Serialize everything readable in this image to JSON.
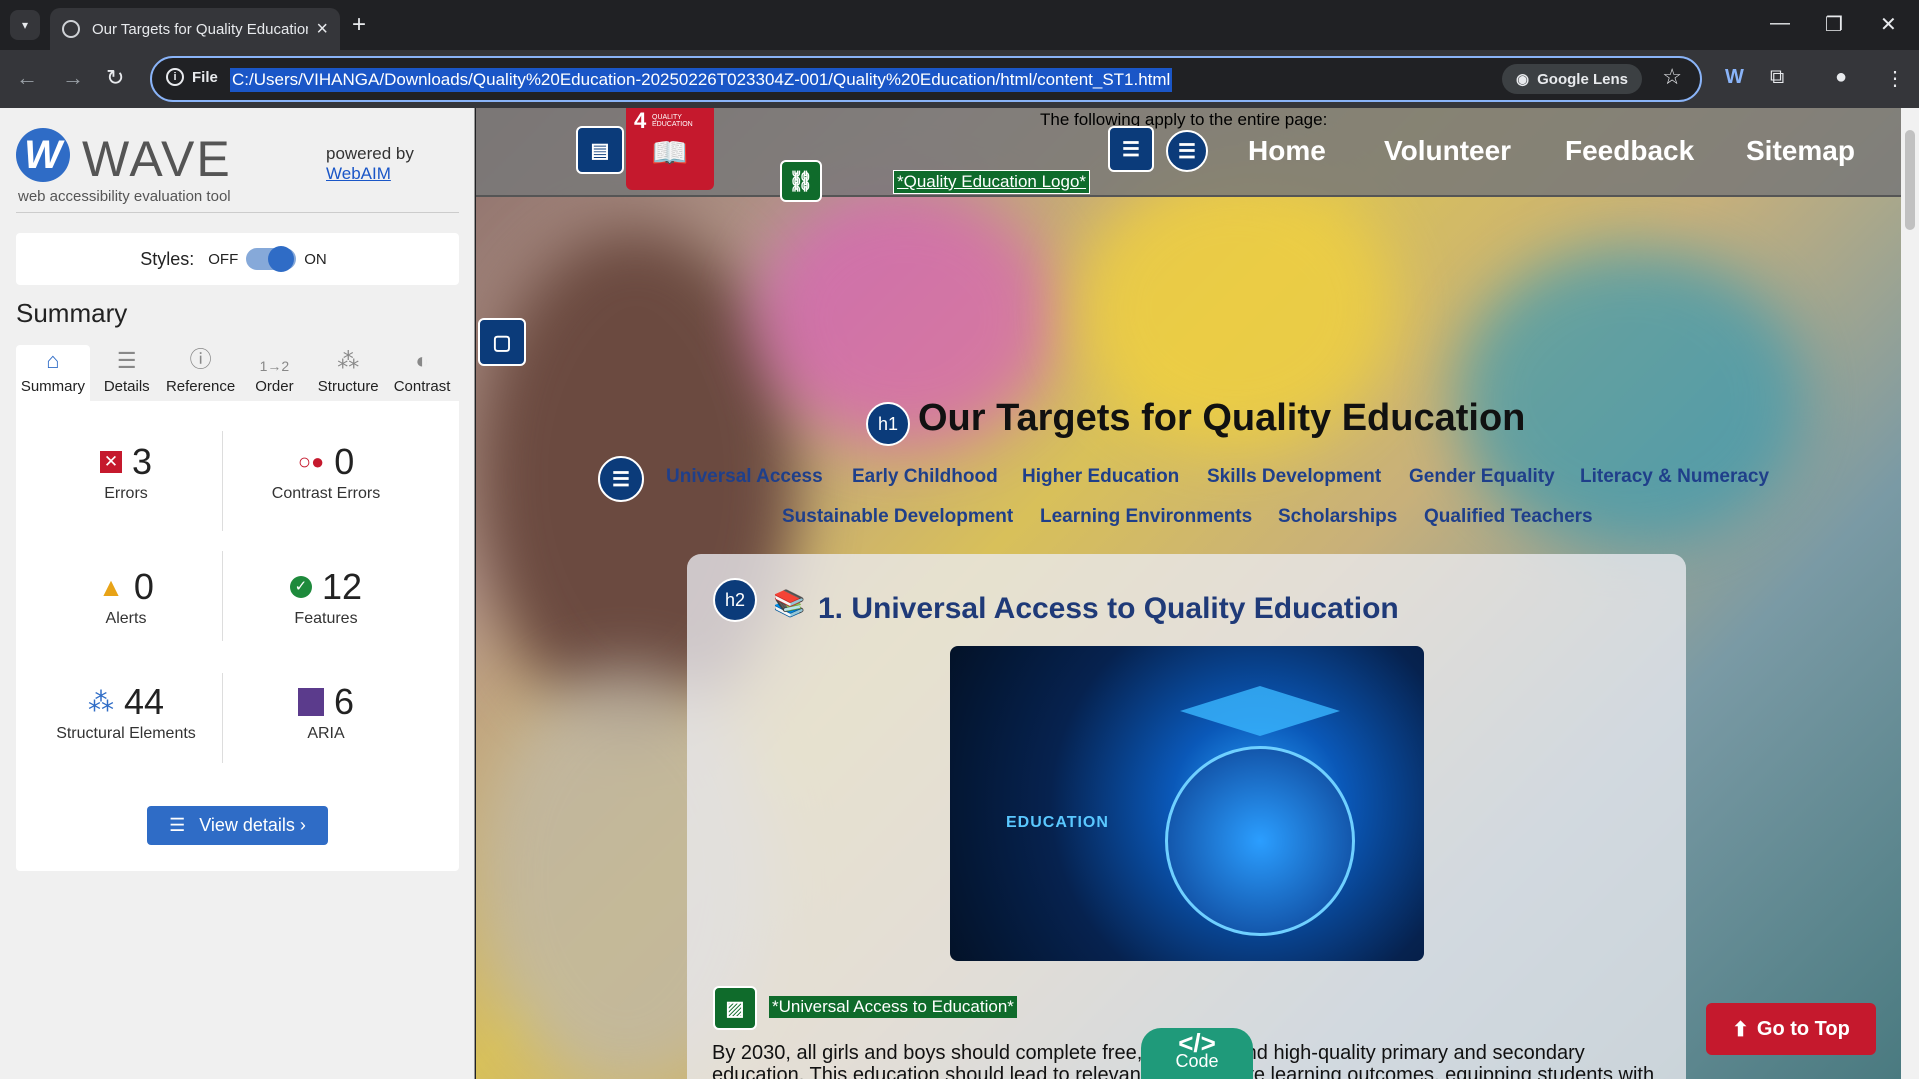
{
  "browser": {
    "tab_title": "Our Targets for Quality Education",
    "url_prefix": "File",
    "url": "C:/Users/VIHANGA/Downloads/Quality%20Education-20250226T023304Z-001/Quality%20Education/html/content_ST1.html",
    "lens_label": "Google Lens"
  },
  "wave": {
    "logo_text": "WAVE",
    "subtitle": "web accessibility evaluation tool",
    "powered_by": "powered by",
    "webaim": "WebAIM",
    "styles_label": "Styles:",
    "styles_off": "OFF",
    "styles_on": "ON",
    "summary_heading": "Summary",
    "tabs": [
      {
        "label": "Summary",
        "icon": "home-icon"
      },
      {
        "label": "Details",
        "icon": "list-icon"
      },
      {
        "label": "Reference",
        "icon": "info-icon"
      },
      {
        "label": "Order",
        "icon": "order-icon"
      },
      {
        "label": "Structure",
        "icon": "structure-icon"
      },
      {
        "label": "Contrast",
        "icon": "contrast-icon"
      }
    ],
    "stats": {
      "errors": {
        "value": "3",
        "label": "Errors"
      },
      "contrast_errors": {
        "value": "0",
        "label": "Contrast Errors"
      },
      "alerts": {
        "value": "0",
        "label": "Alerts"
      },
      "features": {
        "value": "12",
        "label": "Features"
      },
      "structural": {
        "value": "44",
        "label": "Structural Elements"
      },
      "aria": {
        "value": "6",
        "label": "ARIA"
      }
    },
    "view_details": "View details ›",
    "colors": {
      "accent": "#2f6cc6",
      "error": "#c5192d",
      "feature": "#1e8a3c",
      "alert": "#e8a317",
      "aria": "#5b3b8c"
    }
  },
  "site": {
    "applies_text": "The following apply to the entire page:",
    "nav": [
      "Home",
      "Volunteer",
      "Feedback",
      "Sitemap"
    ],
    "logo_alt": "*Quality Education Logo*",
    "sdg_number": "4",
    "sdg_text": "QUALITY EDUCATION",
    "h1_badge": "h1",
    "h2_badge": "h2",
    "title": "Our Targets for Quality Education",
    "toc_row1": [
      "Universal Access",
      "Early Childhood",
      "Higher Education",
      "Skills Development",
      "Gender Equality",
      "Literacy & Numeracy"
    ],
    "toc_row2": [
      "Sustainable Development",
      "Learning Environments",
      "Scholarships",
      "Qualified Teachers"
    ],
    "section_title": "1. Universal Access to Quality Education",
    "hero_text": "EDUCATION",
    "image_alt": "*Universal Access to Education*",
    "paragraph": "By 2030, all girls and boys should complete free, equitable and high-quality primary and secondary education. This education should lead to relevant and effective learning outcomes, equipping students with",
    "go_top": "Go to Top",
    "code_label": "Code"
  }
}
